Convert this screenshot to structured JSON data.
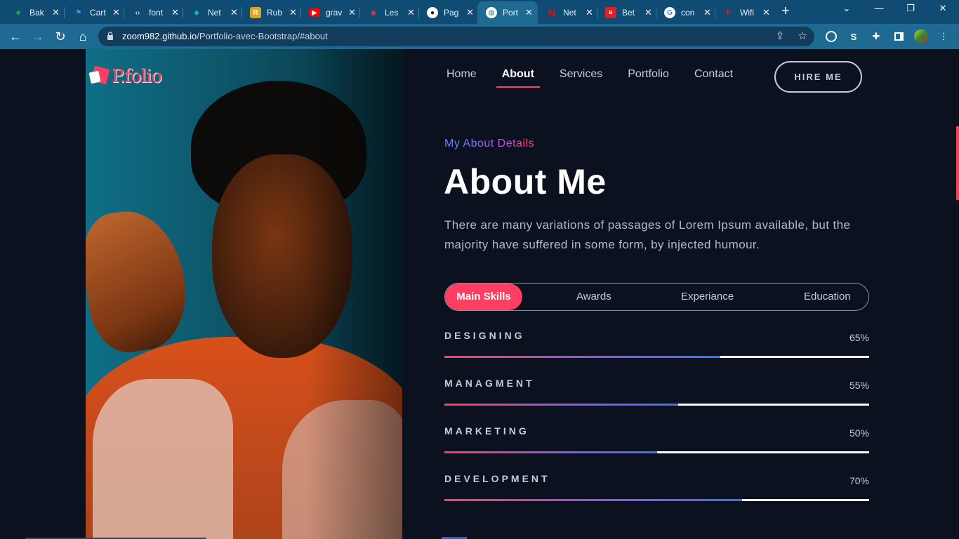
{
  "browser": {
    "tabs": [
      {
        "title": "Bak",
        "favicon": "leaf-icon",
        "color": "#2bb24c"
      },
      {
        "title": "Cart",
        "favicon": "flag-icon",
        "color": "#4d8ff2"
      },
      {
        "title": "font",
        "favicon": "code-icon",
        "color": "#cfd8e3"
      },
      {
        "title": "Net",
        "favicon": "diamond-icon",
        "color": "#18b3a3"
      },
      {
        "title": "Rub",
        "favicon": "rubygems-icon",
        "color": "#e2a320"
      },
      {
        "title": "grav",
        "favicon": "youtube-icon",
        "color": "#ff0000"
      },
      {
        "title": "Les",
        "favicon": "camera-icon",
        "color": "#e3334b"
      },
      {
        "title": "Pag",
        "favicon": "github-icon",
        "color": "#ffffff"
      },
      {
        "title": "Port",
        "favicon": "globe-icon",
        "color": "#ffffff",
        "active": true
      },
      {
        "title": "Net",
        "favicon": "netflix-icon",
        "color": "#e50914"
      },
      {
        "title": "Bet",
        "favicon": "betsoft-icon",
        "color": "#e31e24"
      },
      {
        "title": "con",
        "favicon": "google-icon",
        "color": "#4285f4"
      },
      {
        "title": "Wifi",
        "favicon": "wifi-logo-icon",
        "color": "#d4222a"
      }
    ],
    "url_host": "zoom982.github.io",
    "url_path": "/Portfolio-avec-Bootstrap/#about"
  },
  "site": {
    "logo_text": "P.folio",
    "nav": [
      "Home",
      "About",
      "Services",
      "Portfolio",
      "Contact"
    ],
    "nav_active": "About",
    "hire_label": "HIRE ME"
  },
  "about": {
    "subtitle": "My About Details",
    "title": "About Me",
    "description": "There are many variations of passages of Lorem Ipsum available, but the majority have suffered in some form, by injected humour.",
    "tabs": [
      "Main Skills",
      "Awards",
      "Experiance",
      "Education"
    ],
    "active_tab": "Main Skills",
    "skills": [
      {
        "name": "DESIGNING",
        "percent_label": "65%",
        "value": 65
      },
      {
        "name": "MANAGMENT",
        "percent_label": "55%",
        "value": 55
      },
      {
        "name": "MARKETING",
        "percent_label": "50%",
        "value": 50
      },
      {
        "name": "DEVELOPMENT",
        "percent_label": "70%",
        "value": 70
      }
    ]
  },
  "colors": {
    "accent": "#ff3e61",
    "background": "#0c1120",
    "chrome": "#1f6a93"
  }
}
